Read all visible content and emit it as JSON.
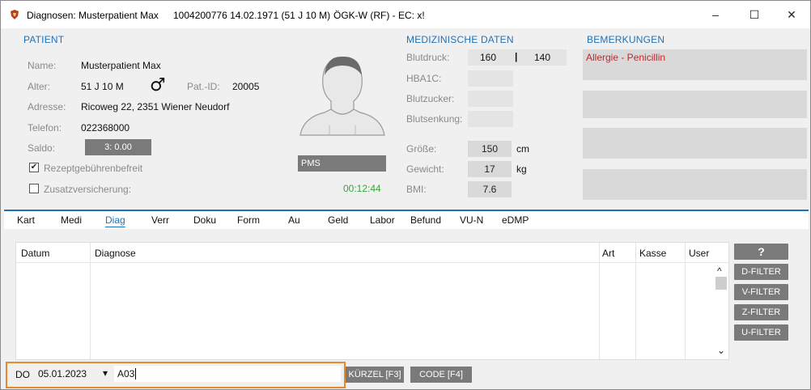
{
  "window": {
    "title": "Diagnosen: Musterpatient Max",
    "title_info": "1004200776 14.02.1971 (51 J 10 M)",
    "title_insurance": "ÖGK-W (RF) - EC: x!",
    "minimize": "–",
    "maximize": "☐",
    "close": "✕"
  },
  "patient": {
    "section_title": "PATIENT",
    "name_label": "Name:",
    "name_value": "Musterpatient Max",
    "age_label": "Alter:",
    "age_value": "51 J 10 M",
    "gender_symbol": "♂",
    "patid_label": "Pat.-ID:",
    "patid_value": "20005",
    "address_label": "Adresse:",
    "address_value": "Ricoweg 22, 2351 Wiener Neudorf",
    "phone_label": "Telefon:",
    "phone_value": "022368000",
    "saldo_label": "Saldo:",
    "saldo_value": "3: 0.00",
    "fee_exempt_label": "Rezeptgebührenbefreit",
    "fee_exempt_checked": "✔",
    "extra_insurance_label": "Zusatzversicherung:",
    "photo_caption": "PMS",
    "timer": "00:12:44"
  },
  "medical": {
    "section_title": "MEDIZINISCHE DATEN",
    "bp_label": "Blutdruck:",
    "bp_sys": "160",
    "bp_sep": "|",
    "bp_dia": "140",
    "hba1c_label": "HBA1C:",
    "sugar_label": "Blutzucker:",
    "sed_label": "Blutsenkung:",
    "height_label": "Größe:",
    "height_value": "150",
    "height_unit": "cm",
    "weight_label": "Gewicht:",
    "weight_value": "17",
    "weight_unit": "kg",
    "bmi_label": "BMI:",
    "bmi_value": "7.6"
  },
  "remarks": {
    "section_title": "BEMERKUNGEN",
    "line1": "Allergie - Penicillin"
  },
  "tabs": [
    "Kart",
    "Medi",
    "Diag",
    "Verr",
    "Doku",
    "Form",
    "Au",
    "Geld",
    "Labor",
    "Befund",
    "VU-N",
    "eDMP"
  ],
  "active_tab": "Diag",
  "table": {
    "col_datum": "Datum",
    "col_diagnose": "Diagnose",
    "col_art": "Art",
    "col_kasse": "Kasse",
    "col_user": "User",
    "scroll_up": "^",
    "scroll_down": "⌄"
  },
  "side_buttons": {
    "help": "?",
    "d_filter": "D-FILTER",
    "v_filter": "V-FILTER",
    "z_filter": "Z-FILTER",
    "u_filter": "U-FILTER"
  },
  "entry": {
    "day": "DO",
    "date": "05.01.2023",
    "dropdown_arrow": "▾",
    "code_input": "A03",
    "kuerzel_button": "KÜRZEL [F3]",
    "code_button": "CODE [F4]"
  },
  "colors": {
    "accent": "#1f72b8",
    "remark_red": "#c0282d",
    "timer_green": "#3aa43a",
    "highlight": "#e8892f"
  }
}
